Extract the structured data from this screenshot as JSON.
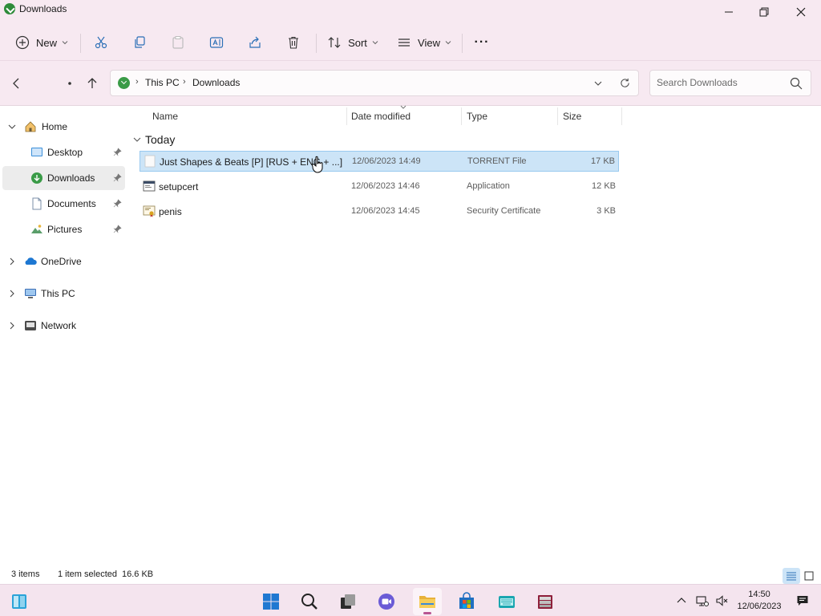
{
  "window": {
    "title": "Downloads"
  },
  "commandbar": {
    "new_label": "New",
    "sort_label": "Sort",
    "view_label": "View",
    "more_label": "···"
  },
  "address": {
    "breadcrumbs": [
      "This PC",
      "Downloads"
    ]
  },
  "search": {
    "placeholder": "Search Downloads"
  },
  "sidebar": {
    "items": [
      {
        "label": "Home",
        "icon": "home-icon"
      },
      {
        "label": "Desktop",
        "icon": "desktop-icon",
        "pinned": true
      },
      {
        "label": "Downloads",
        "icon": "downloads-icon",
        "pinned": true,
        "selected": true
      },
      {
        "label": "Documents",
        "icon": "documents-icon",
        "pinned": true
      },
      {
        "label": "Pictures",
        "icon": "pictures-icon",
        "pinned": true
      },
      {
        "label": "OneDrive",
        "icon": "onedrive-icon"
      },
      {
        "label": "This PC",
        "icon": "this-pc-icon"
      },
      {
        "label": "Network",
        "icon": "network-icon"
      }
    ]
  },
  "columns": {
    "name": "Name",
    "date": "Date modified",
    "type": "Type",
    "size": "Size"
  },
  "group": {
    "label": "Today"
  },
  "files": [
    {
      "name": "Just Shapes & Beats [P] [RUS + ENG + ...] (...",
      "date": "12/06/2023 14:49",
      "type": "TORRENT File",
      "size": "17 KB",
      "selected": true
    },
    {
      "name": "setupcert",
      "date": "12/06/2023 14:46",
      "type": "Application",
      "size": "12 KB"
    },
    {
      "name": "penis",
      "date": "12/06/2023 14:45",
      "type": "Security Certificate",
      "size": "3 KB"
    }
  ],
  "status": {
    "count": "3 items",
    "selection": "1 item selected",
    "selection_size": "16.6 KB"
  },
  "clock": {
    "time": "14:50",
    "date": "12/06/2023"
  },
  "colors": {
    "accent": "#0067c0",
    "selection": "#cce4f7",
    "chrome": "#f7e9f1"
  }
}
